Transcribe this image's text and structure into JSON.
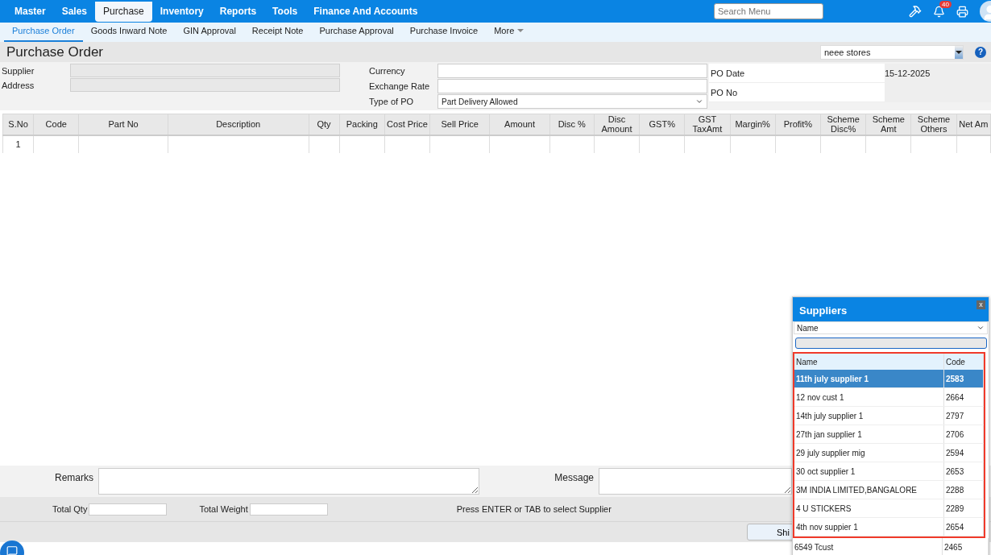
{
  "top_nav": {
    "items": [
      {
        "label": "Master",
        "selected": false
      },
      {
        "label": "Sales",
        "selected": false
      },
      {
        "label": "Purchase",
        "selected": true
      },
      {
        "label": "Inventory",
        "selected": false
      },
      {
        "label": "Reports",
        "selected": false
      },
      {
        "label": "Tools",
        "selected": false
      },
      {
        "label": "Finance And Accounts",
        "selected": false
      }
    ],
    "search": {
      "placeholder": "Search Menu"
    },
    "notification_badge": "40"
  },
  "sub_nav": {
    "tabs": [
      {
        "label": "Purchase Order",
        "selected": true
      },
      {
        "label": "Goods Inward Note",
        "selected": false
      },
      {
        "label": "GIN Approval",
        "selected": false
      },
      {
        "label": "Receipt Note",
        "selected": false
      },
      {
        "label": "Purchase Approval",
        "selected": false
      },
      {
        "label": "Purchase Invoice",
        "selected": false
      }
    ],
    "more": "More"
  },
  "page_title": "Purchase Order",
  "store_select": "neee stores",
  "help": "?",
  "form": {
    "supplier_label": "Supplier",
    "address_label": "Address",
    "currency_label": "Currency",
    "exchange_rate_label": "Exchange Rate",
    "type_of_po_label": "Type of PO",
    "type_of_po_value": "Part Delivery Allowed",
    "po_date_label": "PO Date",
    "po_date_value": "15-12-2025",
    "po_no_label": "PO No"
  },
  "table": {
    "columns": [
      "S.No",
      "Code",
      "Part No",
      "Description",
      "Qty",
      "Packing",
      "Cost Price",
      "Sell Price",
      "Amount",
      "Disc %",
      "Disc Amount",
      "GST%",
      "GST TaxAmt",
      "Margin%",
      "Profit%",
      "Scheme Disc%",
      "Scheme Amt",
      "Scheme Others",
      "Net Am"
    ],
    "rows": [
      {
        "sno": "1"
      }
    ]
  },
  "footer": {
    "remarks_label": "Remarks",
    "message_label": "Message",
    "total_qty_label": "Total Qty",
    "total_weight_label": "Total Weight",
    "hint": "Press ENTER or TAB to select Supplier",
    "button": "Shi"
  },
  "suppliers_popup": {
    "title": "Suppliers",
    "close": "x",
    "search_by": "Name",
    "columns": [
      "Name",
      "Code"
    ],
    "rows": [
      {
        "name": "11th july supplier 1",
        "code": "2583",
        "selected": true
      },
      {
        "name": "12 nov cust 1",
        "code": "2664",
        "selected": false
      },
      {
        "name": "14th july supplier 1",
        "code": "2797",
        "selected": false
      },
      {
        "name": "27th jan supplier 1",
        "code": "2706",
        "selected": false
      },
      {
        "name": "29 july supplier mig",
        "code": "2594",
        "selected": false
      },
      {
        "name": "30 oct supplier 1",
        "code": "2653",
        "selected": false
      },
      {
        "name": "3M INDIA LIMITED,BANGALORE",
        "code": "2288",
        "selected": false
      },
      {
        "name": "4 U STICKERS",
        "code": "2289",
        "selected": false
      },
      {
        "name": "4th nov suppier 1",
        "code": "2654",
        "selected": false
      },
      {
        "name": "6549 Tcust",
        "code": "2465",
        "selected": false
      }
    ]
  }
}
